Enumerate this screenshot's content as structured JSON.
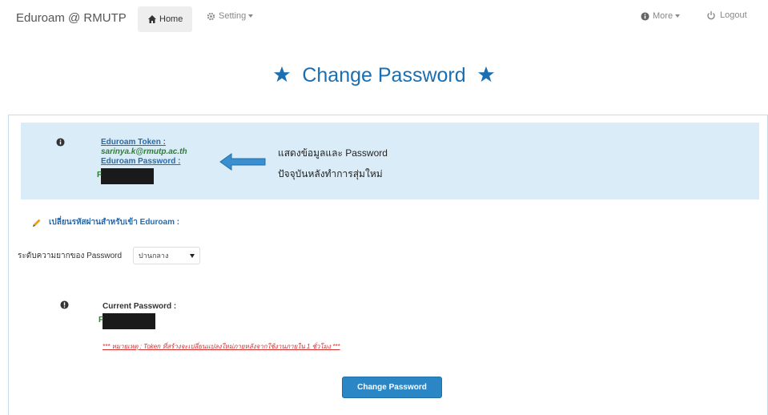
{
  "navbar": {
    "brand": "Eduroam @ RMUTP",
    "home": "Home",
    "setting": "Setting",
    "more": "More",
    "logout": "Logout"
  },
  "page": {
    "title": "Change Password"
  },
  "info": {
    "token_label": "Eduroam Token :",
    "token_value": "sarinya.k@rmutp.ac.th",
    "password_label": "Eduroam Password :",
    "password_first_char": "F",
    "annotation_line1": "แสดงข้อมูลและ Password",
    "annotation_line2": "ปัจจุบันหลังทำการสุ่มใหม่"
  },
  "form": {
    "edit_heading": "เปลี่ยนรหัสผ่านสำหรับเข้า Eduroam :",
    "level_label": "ระดับความยากของ Password",
    "level_value": "ปานกลาง",
    "current_label": "Current Password :",
    "current_first_char": "F",
    "note": "*** หมายเหตุ : Token ที่สร้างจะเปลี่ยนแปลงใหม่ภายหลังจากใช้งานภายใน 1 ชั่วโมง ***",
    "submit_label": "Change Password"
  },
  "colors": {
    "accent": "#1a6fb3",
    "info_bg": "#d9ecf8",
    "button": "#2b86c5",
    "link_blue": "#2a6aa8",
    "value_green": "#2e7d32",
    "warning_red": "#d32f2f"
  }
}
